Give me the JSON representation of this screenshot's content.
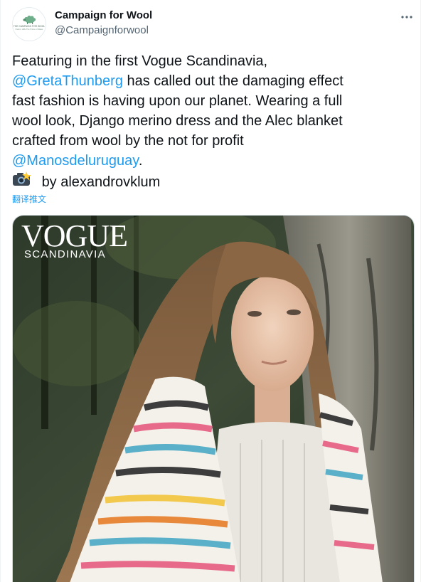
{
  "author": {
    "display_name": "Campaign for Wool",
    "handle": "@Campaignforwool",
    "avatar_text_line1": "THE CAMPAIGN FOR WOOL",
    "avatar_text_line2": "Patron: HRH The Prince of Wales"
  },
  "tweet": {
    "line1": "Featuring in the first Vogue Scandinavia,",
    "mention1": "@GretaThunberg",
    "line2_rest": " has called out the damaging effect",
    "line3": "fast fashion is having upon our planet. Wearing a full",
    "line4": "wool look, Django merino dress and the Alec blanket",
    "line5": "crafted from wool by the not for profit",
    "mention2": "@Manosdeluruguay",
    "line6_rest": ".",
    "credit_emoji": "camera-flash-icon",
    "credit_text": "by alexandrovklum"
  },
  "translate_label": "翻译推文",
  "media": {
    "magazine_title": "VOGUE",
    "magazine_subtitle": "SCANDINAVIA"
  },
  "colors": {
    "link": "#1d9bf0",
    "text": "#0f1419",
    "secondary": "#536471"
  },
  "icons": {
    "more": "more-dots-icon"
  }
}
